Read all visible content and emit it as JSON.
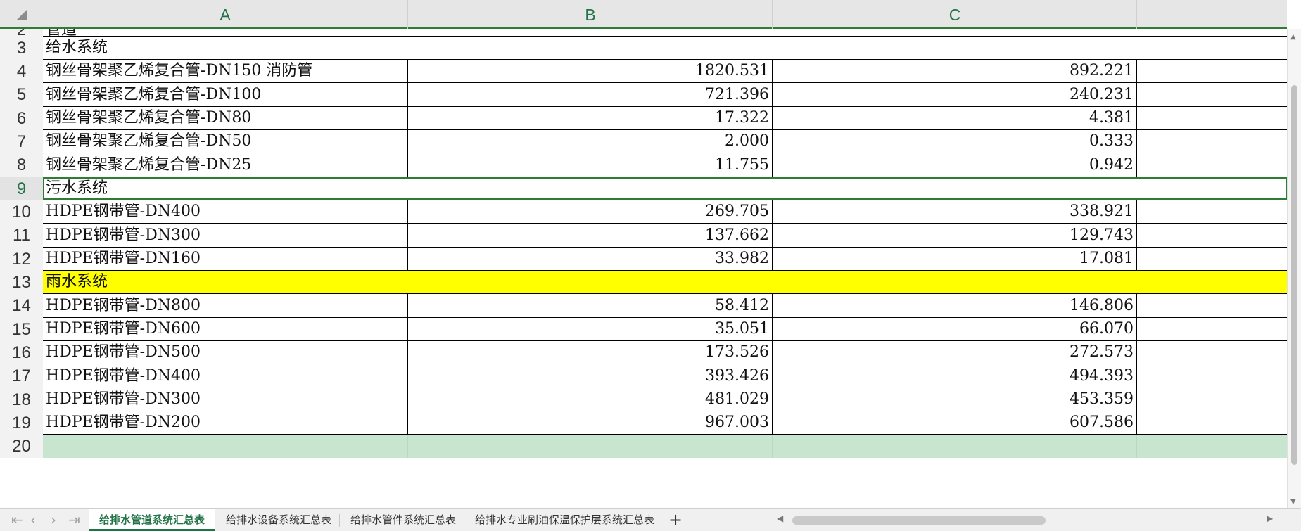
{
  "columns": [
    "A",
    "B",
    "C"
  ],
  "rows": [
    {
      "num": "2",
      "type": "partial",
      "label": "管道"
    },
    {
      "num": "3",
      "type": "section",
      "label": "给水系统"
    },
    {
      "num": "4",
      "type": "data",
      "a": "钢丝骨架聚乙烯复合管-DN150 消防管",
      "b": "1820.531",
      "c": "892.221"
    },
    {
      "num": "5",
      "type": "data",
      "a": "钢丝骨架聚乙烯复合管-DN100",
      "b": "721.396",
      "c": "240.231"
    },
    {
      "num": "6",
      "type": "data",
      "a": "钢丝骨架聚乙烯复合管-DN80",
      "b": "17.322",
      "c": "4.381"
    },
    {
      "num": "7",
      "type": "data",
      "a": "钢丝骨架聚乙烯复合管-DN50",
      "b": "2.000",
      "c": "0.333"
    },
    {
      "num": "8",
      "type": "data",
      "a": "钢丝骨架聚乙烯复合管-DN25",
      "b": "11.755",
      "c": "0.942"
    },
    {
      "num": "9",
      "type": "section",
      "label": "污水系统",
      "selected": true
    },
    {
      "num": "10",
      "type": "data",
      "a": "HDPE钢带管-DN400",
      "b": "269.705",
      "c": "338.921"
    },
    {
      "num": "11",
      "type": "data",
      "a": "HDPE钢带管-DN300",
      "b": "137.662",
      "c": "129.743"
    },
    {
      "num": "12",
      "type": "data",
      "a": "HDPE钢带管-DN160",
      "b": "33.982",
      "c": "17.081"
    },
    {
      "num": "13",
      "type": "section",
      "label": "雨水系统",
      "highlight": "#ffff00"
    },
    {
      "num": "14",
      "type": "data",
      "a": "HDPE钢带管-DN800",
      "b": "58.412",
      "c": "146.806"
    },
    {
      "num": "15",
      "type": "data",
      "a": "HDPE钢带管-DN600",
      "b": "35.051",
      "c": "66.070"
    },
    {
      "num": "16",
      "type": "data",
      "a": "HDPE钢带管-DN500",
      "b": "173.526",
      "c": "272.573"
    },
    {
      "num": "17",
      "type": "data",
      "a": "HDPE钢带管-DN400",
      "b": "393.426",
      "c": "494.393"
    },
    {
      "num": "18",
      "type": "data",
      "a": "HDPE钢带管-DN300",
      "b": "481.029",
      "c": "453.359"
    },
    {
      "num": "19",
      "type": "data",
      "a": "HDPE钢带管-DN200",
      "b": "967.003",
      "c": "607.586"
    },
    {
      "num": "20",
      "type": "empty"
    }
  ],
  "tabs": [
    {
      "label": "给排水管道系统汇总表",
      "active": true
    },
    {
      "label": "给排水设备系统汇总表",
      "active": false
    },
    {
      "label": "给排水管件系统汇总表",
      "active": false
    },
    {
      "label": "给排水专业刷油保温保护层系统汇总表",
      "active": false
    }
  ],
  "add_sheet_label": "+",
  "colors": {
    "accent": "#217346",
    "highlight": "#ffff00",
    "selection_fill": "#c8e6cf"
  }
}
